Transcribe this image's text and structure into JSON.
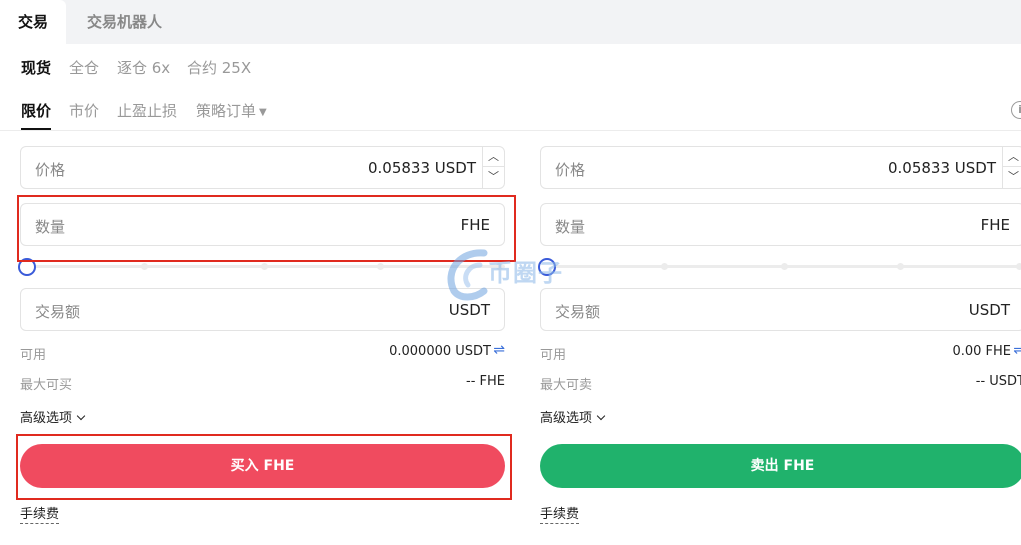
{
  "top_tabs": {
    "trade": "交易",
    "bot": "交易机器人"
  },
  "modes": {
    "spot": "现货",
    "cross": "全仓",
    "isolated": "逐仓 6x",
    "contract": "合约 25X"
  },
  "order_types": {
    "limit": "限价",
    "market": "市价",
    "tpsl": "止盈止损",
    "strategy": "策略订单"
  },
  "info_icon_glyph": "i",
  "buy": {
    "price_label": "价格",
    "price_value": "0.05833 USDT",
    "qty_label": "数量",
    "qty_value": "FHE",
    "amount_label": "交易额",
    "amount_value": "USDT",
    "available_label": "可用",
    "available_value": "0.000000 USDT",
    "max_label": "最大可买",
    "max_value": "-- FHE",
    "advanced": "高级选项",
    "button": "买入 FHE",
    "fee": "手续费"
  },
  "sell": {
    "price_label": "价格",
    "price_value": "0.05833 USDT",
    "qty_label": "数量",
    "qty_value": "FHE",
    "amount_label": "交易额",
    "amount_value": "USDT",
    "available_label": "可用",
    "available_value": "0.00 FHE",
    "max_label": "最大可卖",
    "max_value": "-- USDT",
    "advanced": "高级选项",
    "button": "卖出 FHE",
    "fee": "手续费"
  },
  "glyphs": {
    "stepper_up": "︿",
    "stepper_down": "﹀",
    "swap": "⇌",
    "caret": "▼"
  },
  "colors": {
    "buy": "#f04b5f",
    "sell": "#20b26c",
    "highlight": "#e02a1f",
    "slider_knob": "#3a5bd9"
  },
  "watermark": {
    "text": "币圈子"
  }
}
